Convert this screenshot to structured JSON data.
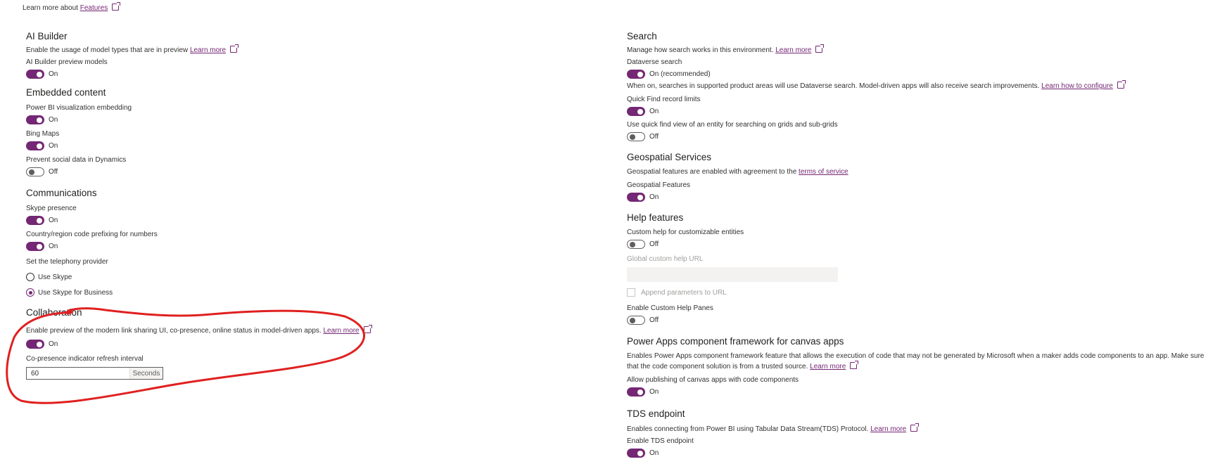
{
  "header": {
    "learn_more_prefix": "Learn more about",
    "learn_more_link": "Features"
  },
  "left": {
    "ai_builder": {
      "title": "AI Builder",
      "desc": "Enable the usage of model types that are in preview",
      "desc_link": "Learn more",
      "preview_label": "AI Builder preview models",
      "preview_state": "On"
    },
    "embedded": {
      "title": "Embedded content",
      "powerbi_label": "Power BI visualization embedding",
      "powerbi_state": "On",
      "bing_label": "Bing Maps",
      "bing_state": "On",
      "social_label": "Prevent social data in Dynamics",
      "social_state": "Off"
    },
    "communications": {
      "title": "Communications",
      "skype_label": "Skype presence",
      "skype_state": "On",
      "country_label": "Country/region code prefixing for numbers",
      "country_state": "On",
      "telephony_label": "Set the telephony provider",
      "options": [
        "Use Skype",
        "Use Skype for Business"
      ],
      "selected": "Use Skype for Business"
    },
    "collaboration": {
      "title": "Collaboration",
      "desc": "Enable preview of the modern link sharing UI, co-presence, online status in model-driven apps.",
      "desc_link": "Learn more",
      "toggle_state": "On",
      "interval_label": "Co-presence indicator refresh interval",
      "interval_value": "60",
      "interval_suffix": "Seconds"
    }
  },
  "right": {
    "search": {
      "title": "Search",
      "desc": "Manage how search works in this environment.",
      "desc_link": "Learn more",
      "dataverse_label": "Dataverse search",
      "dataverse_state": "On (recommended)",
      "dataverse_note": "When on, searches in supported product areas will use Dataverse search. Model-driven apps will also receive search improvements.",
      "dataverse_note_link": "Learn how to configure",
      "quickfind_label": "Quick Find record limits",
      "quickfind_state": "On",
      "quickview_label": "Use quick find view of an entity for searching on grids and sub-grids",
      "quickview_state": "Off"
    },
    "geo": {
      "title": "Geospatial Services",
      "desc": "Geospatial features are enabled with agreement to the",
      "desc_link": "terms of service",
      "features_label": "Geospatial Features",
      "features_state": "On"
    },
    "help": {
      "title": "Help features",
      "custom_label": "Custom help for customizable entities",
      "custom_state": "Off",
      "url_label": "Global custom help URL",
      "append_label": "Append parameters to URL",
      "panes_label": "Enable Custom Help Panes",
      "panes_state": "Off"
    },
    "pcf": {
      "title": "Power Apps component framework for canvas apps",
      "desc": "Enables Power Apps component framework feature that allows the execution of code that may not be generated by Microsoft when a maker adds code components to an app. Make sure that the code component solution is from a trusted source.",
      "desc_link": "Learn more",
      "publish_label": "Allow publishing of canvas apps with code components",
      "publish_state": "On"
    },
    "tds": {
      "title": "TDS endpoint",
      "desc": "Enables connecting from Power BI using Tabular Data Stream(TDS) Protocol.",
      "desc_link": "Learn more",
      "enable_label": "Enable TDS endpoint",
      "enable_state": "On"
    }
  },
  "colors": {
    "accent": "#742774",
    "annotation": "#e02020"
  }
}
